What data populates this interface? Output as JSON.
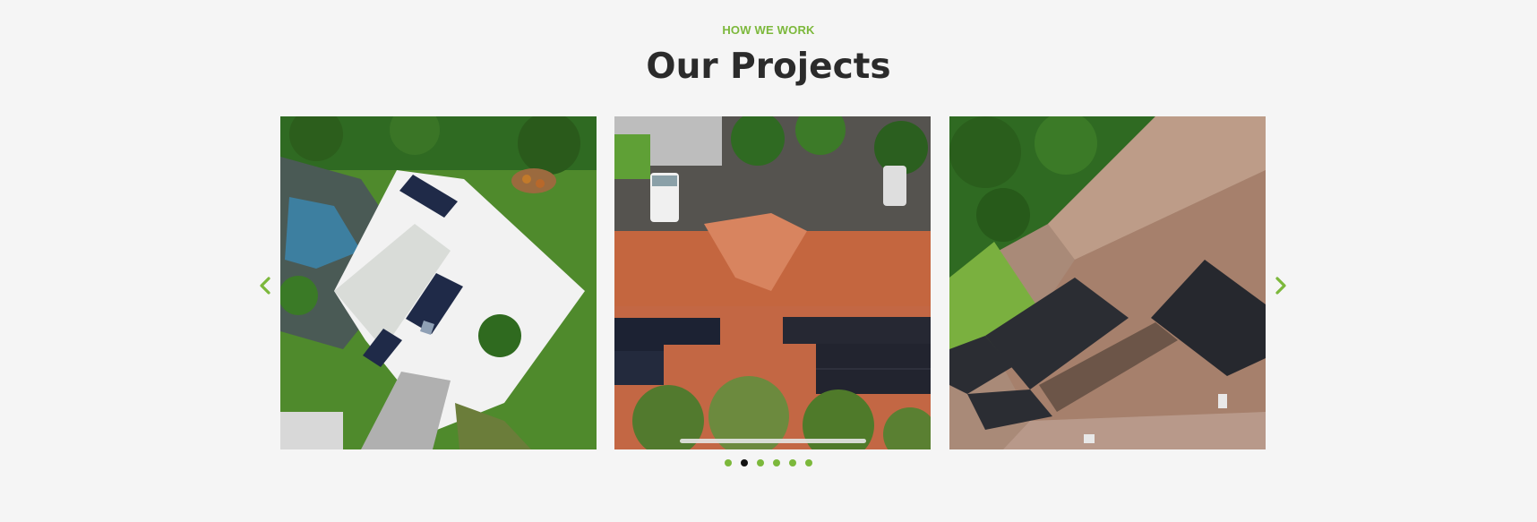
{
  "section": {
    "eyebrow": "HOW WE WORK",
    "title": "Our Projects"
  },
  "carousel": {
    "slides": [
      {
        "icon": "project-photo-white-roof-icon"
      },
      {
        "icon": "project-photo-tile-roof-icon"
      },
      {
        "icon": "project-photo-brown-roof-icon"
      }
    ],
    "dot_count": 6,
    "active_dot": 2
  },
  "colors": {
    "accent": "#7cb83b",
    "title": "#2b2b2b",
    "background": "#f5f5f5",
    "active_dot": "#111111"
  }
}
